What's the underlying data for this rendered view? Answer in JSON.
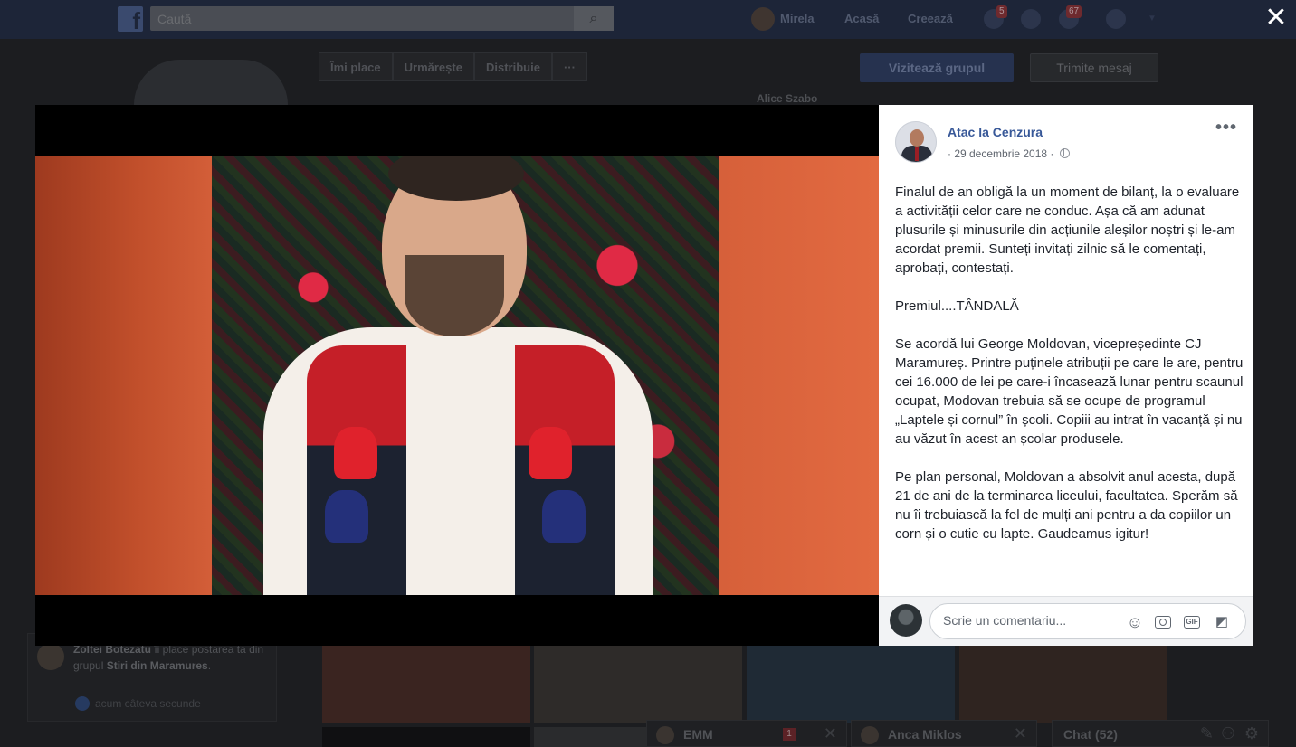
{
  "topbar": {
    "search_placeholder": "Caută",
    "profile_name": "Mirela",
    "nav_home": "Acasă",
    "nav_create": "Creează",
    "friend_requests_count": "5",
    "notifications_count": "67"
  },
  "background": {
    "actions": [
      "Îmi place",
      "Urmărește",
      "Distribuie",
      "···"
    ],
    "visit_group_label": "Vizitează grupul",
    "send_message_label": "Trimite mesaj",
    "member_name": "Alice Szabo",
    "notification": {
      "user": "Zoltei Botezatu",
      "text_middle": " îi place postarea ta din grupul ",
      "group": "Stiri din Maramures",
      "end": ".",
      "time": "acum câteva secunde"
    },
    "chat_tabs": [
      {
        "label": "EMM",
        "count": "1"
      },
      {
        "label": "Anca Miklos"
      }
    ],
    "chat_label": "Chat (52)"
  },
  "viewer": {
    "close_label": "✕",
    "post": {
      "page_name": "Atac la Cenzura",
      "date": "· 29 decembrie 2018 ·",
      "paragraphs": [
        "Finalul de an obligă la un moment de bilanț, la o evaluare a activității celor care ne conduc. Așa că am adunat plusurile și minusurile din acțiunile aleșilor noștri și le-am acordat premii. Sunteți invitați zilnic să le comentați, aprobați, contestați.",
        "Premiul....TÂNDALĂ",
        "Se acordă lui George Moldovan, vicepreședinte CJ Maramureș. Printre puținele atribuții pe care le are, pentru cei 16.000 de lei pe care-i încasează lunar pentru scaunul ocupat, Modovan trebuia să se ocupe de programul „Laptele și cornul” în școli. Copiii au intrat în vacanță și nu au văzut în acest an școlar produsele.",
        "Pe plan personal, Moldovan a absolvit anul acesta, după 21 de ani de la terminarea liceului, facultatea. Sperăm să nu îi trebuiască la fel de mulți ani pentru a da copiilor un corn și o cutie cu lapte. Gaudeamus igitur!"
      ]
    },
    "comment": {
      "placeholder": "Scrie un comentariu...",
      "gif_label": "GIF"
    }
  }
}
